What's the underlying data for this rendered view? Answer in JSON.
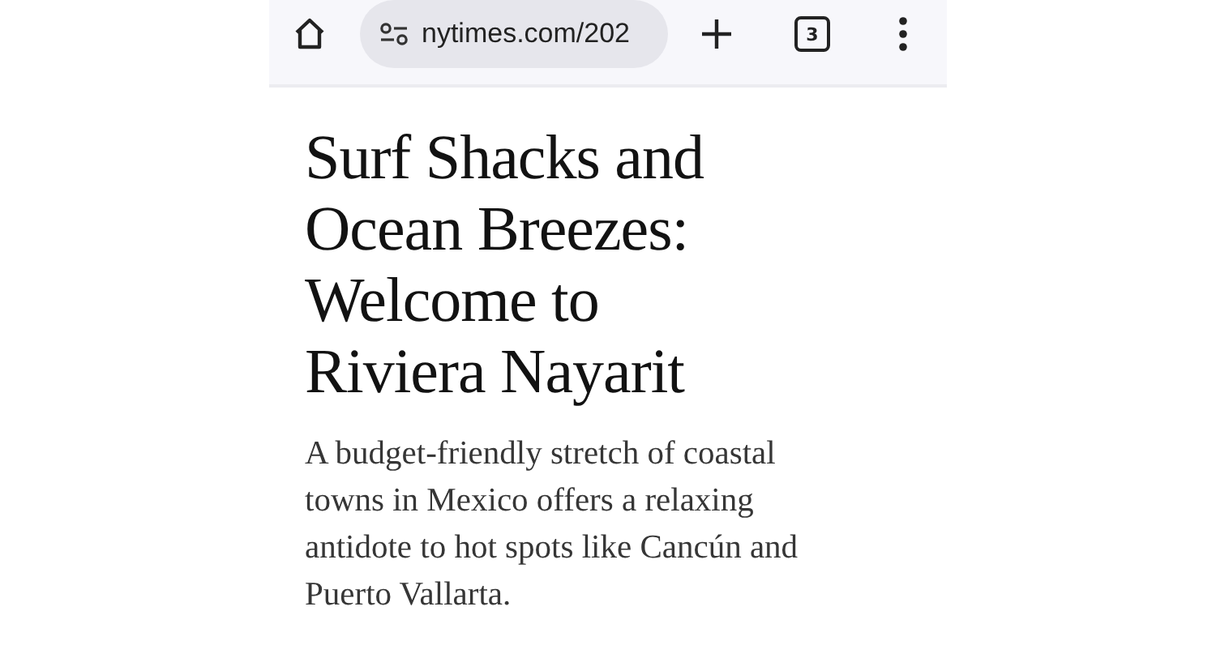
{
  "toolbar": {
    "url": "nytimes.com/202",
    "tab_count": "3"
  },
  "article": {
    "headline_lines": [
      "Surf Shacks and",
      "Ocean Breezes:",
      "Welcome to",
      "Riviera Nayarit"
    ],
    "summary_lines": [
      "A budget-friendly stretch of coastal",
      "towns in Mexico offers a relaxing",
      "antidote to hot spots like Cancún and",
      "Puerto Vallarta."
    ]
  }
}
